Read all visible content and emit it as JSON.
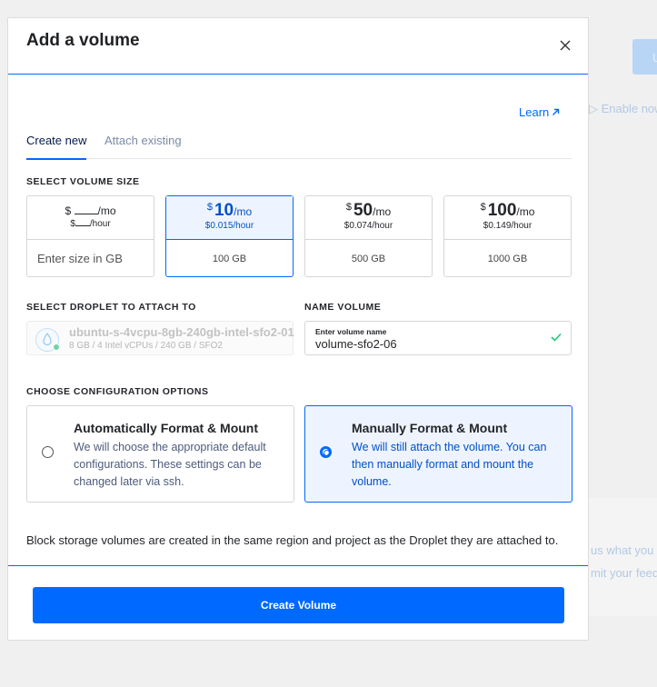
{
  "background": {
    "button_label": "U",
    "enable_now": "Enable now",
    "feedback_line1": "us what you t",
    "feedback_line2": "mit your feed"
  },
  "modal": {
    "title": "Add a volume",
    "learn_label": "Learn",
    "tabs": [
      {
        "label": "Create new",
        "active": true
      },
      {
        "label": "Attach existing",
        "active": false
      }
    ],
    "volume_size": {
      "section_label": "SELECT VOLUME SIZE",
      "custom": {
        "dollar": "$",
        "per_month": "/mo",
        "per_hour": "/hour",
        "placeholder": "Enter size in GB"
      },
      "options": [
        {
          "dollar": "$",
          "price": "10",
          "per_month": "/mo",
          "hourly": "$0.015/hour",
          "size": "100 GB",
          "selected": true
        },
        {
          "dollar": "$",
          "price": "50",
          "per_month": "/mo",
          "hourly": "$0.074/hour",
          "size": "500 GB",
          "selected": false
        },
        {
          "dollar": "$",
          "price": "100",
          "per_month": "/mo",
          "hourly": "$0.149/hour",
          "size": "1000 GB",
          "selected": false
        }
      ]
    },
    "droplet": {
      "section_label": "SELECT DROPLET TO ATTACH TO",
      "name": "ubuntu-s-4vcpu-8gb-240gb-intel-sfo2-01",
      "specs": "8 GB / 4 Intel vCPUs / 240 GB / SFO2"
    },
    "name_volume": {
      "section_label": "NAME VOLUME",
      "field_label": "Enter volume name",
      "value": "volume-sfo2-06"
    },
    "config": {
      "section_label": "CHOOSE CONFIGURATION OPTIONS",
      "options": [
        {
          "title": "Automatically Format & Mount",
          "description": "We will choose the appropriate default configurations. These settings can be changed later via ssh.",
          "selected": false
        },
        {
          "title": "Manually Format & Mount",
          "description": "We will still attach the volume. You can then manually format and mount the volume.",
          "selected": true
        }
      ]
    },
    "note": "Block storage volumes are created in the same region and project as the Droplet they are attached to.",
    "create_button": "Create Volume"
  },
  "colors": {
    "primary": "#0069ff",
    "selected_bg": "#eef4ff",
    "check": "#15cd72"
  }
}
